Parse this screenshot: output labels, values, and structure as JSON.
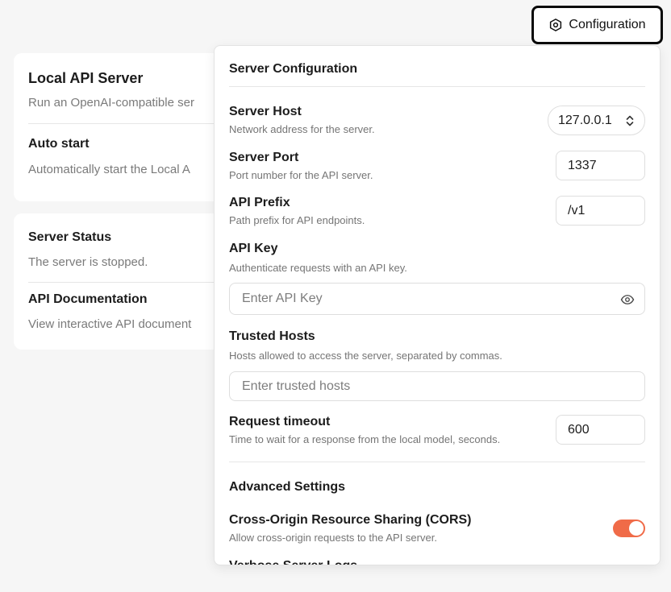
{
  "header": {
    "config_button_label": "Configuration"
  },
  "background": {
    "card_a": {
      "local_api_server": {
        "title": "Local API Server",
        "desc": "Run an OpenAI-compatible ser"
      },
      "auto_start": {
        "title": "Auto start",
        "desc": "Automatically start the Local A"
      }
    },
    "card_b": {
      "server_status": {
        "title": "Server Status",
        "desc": "The server is stopped."
      },
      "api_docs": {
        "title": "API Documentation",
        "desc": "View interactive API document"
      }
    }
  },
  "panel": {
    "title": "Server Configuration",
    "server_host": {
      "label": "Server Host",
      "desc": "Network address for the server.",
      "value": "127.0.0.1"
    },
    "server_port": {
      "label": "Server Port",
      "desc": "Port number for the API server.",
      "value": "1337"
    },
    "api_prefix": {
      "label": "API Prefix",
      "desc": "Path prefix for API endpoints.",
      "value": "/v1"
    },
    "api_key": {
      "label": "API Key",
      "desc": "Authenticate requests with an API key.",
      "placeholder": "Enter API Key"
    },
    "trusted_hosts": {
      "label": "Trusted Hosts",
      "desc": "Hosts allowed to access the server, separated by commas.",
      "placeholder": "Enter trusted hosts"
    },
    "request_timeout": {
      "label": "Request timeout",
      "desc": "Time to wait for a response from the local model, seconds.",
      "value": "600"
    },
    "advanced_title": "Advanced Settings",
    "cors": {
      "label": "Cross-Origin Resource Sharing (CORS)",
      "desc": "Allow cross-origin requests to the API server.",
      "enabled": true
    },
    "verbose_logs": {
      "label": "Verbose Server Logs"
    }
  },
  "colors": {
    "accent": "#f06b48",
    "border": "#dedede",
    "muted": "#757575"
  }
}
